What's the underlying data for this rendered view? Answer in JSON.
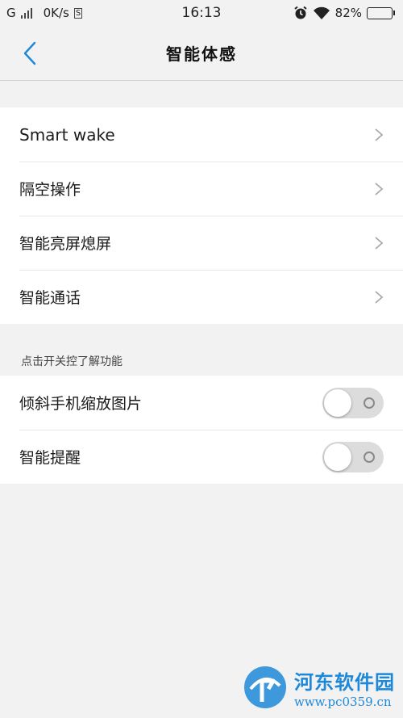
{
  "status_bar": {
    "carrier": "G",
    "speed": "0K/s",
    "sim_icon_text": "S",
    "time": "16:13",
    "battery_percent": "82%",
    "battery_level": 0.82
  },
  "header": {
    "title": "智能体感"
  },
  "main": {
    "items": [
      {
        "label": "Smart wake"
      },
      {
        "label": "隔空操作"
      },
      {
        "label": "智能亮屏熄屏"
      },
      {
        "label": "智能通话"
      }
    ],
    "toggle_section_title": "点击开关控了解功能",
    "toggles": [
      {
        "label": "倾斜手机缩放图片",
        "on": false
      },
      {
        "label": "智能提醒",
        "on": false
      }
    ]
  },
  "watermark": {
    "title": "河东软件园",
    "url": "www.pc0359.cn"
  },
  "colors": {
    "accent": "#1e88d8",
    "background": "#f2f2f2",
    "toggle_off": "#dcdcdc"
  }
}
